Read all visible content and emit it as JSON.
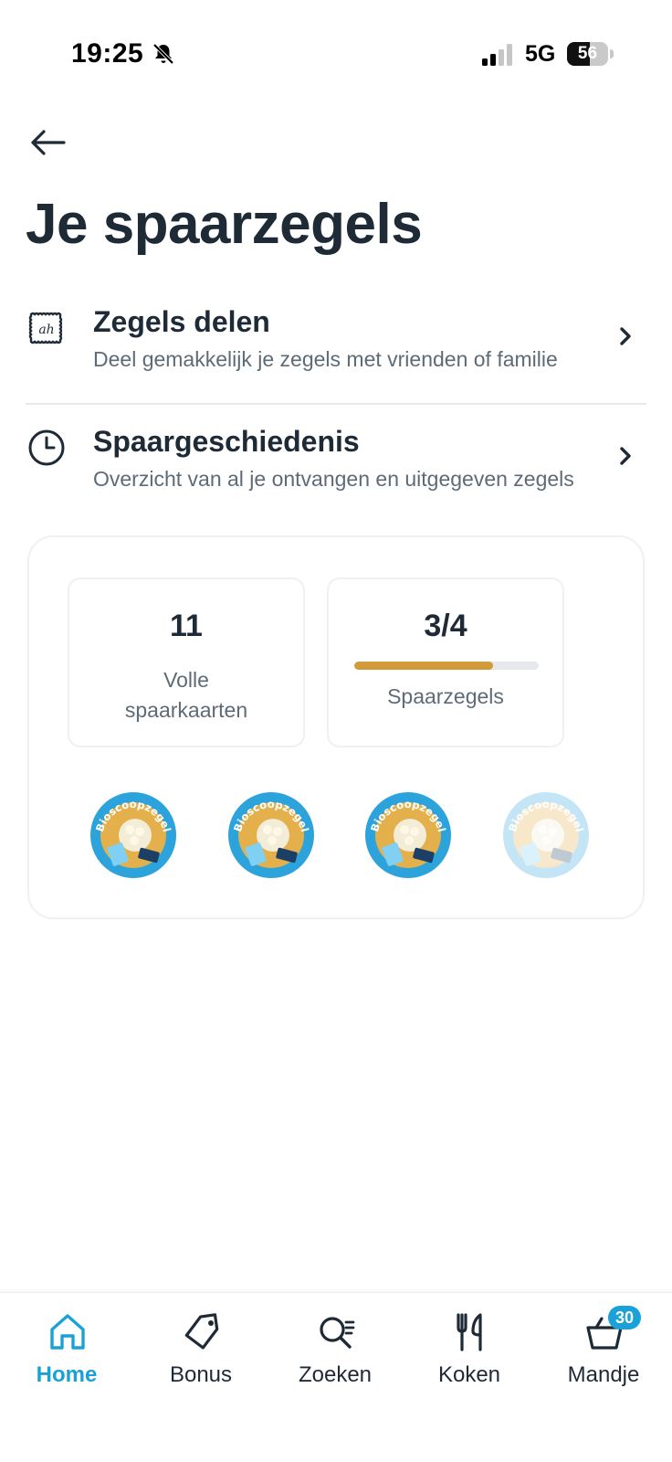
{
  "status_bar": {
    "time": "19:25",
    "network": "5G",
    "battery": "56",
    "battery_level": 0.56
  },
  "header": {
    "title": "Je spaarzegels"
  },
  "menu": [
    {
      "title": "Zegels delen",
      "subtitle": "Deel gemakkelijk je zegels met vrienden of familie",
      "icon": "ah-stamp-icon"
    },
    {
      "title": "Spaargeschiedenis",
      "subtitle": "Overzicht van al je ontvangen en uitgegeven zegels",
      "icon": "clock-icon"
    }
  ],
  "summary": {
    "full_cards_value": "11",
    "full_cards_label_line1": "Volle",
    "full_cards_label_line2": "spaarkaarten",
    "stamps_value": "3/4",
    "stamps_label": "Spaarzegels",
    "stamps_progress": 0.75,
    "stamp_text": "Bioscoopzegel",
    "stamps_collected": 3,
    "stamps_total": 4
  },
  "bottom_nav": [
    {
      "label": "Home",
      "icon": "home-icon",
      "active": true
    },
    {
      "label": "Bonus",
      "icon": "tag-icon",
      "active": false
    },
    {
      "label": "Zoeken",
      "icon": "search-icon",
      "active": false
    },
    {
      "label": "Koken",
      "icon": "cutlery-icon",
      "active": false
    },
    {
      "label": "Mandje",
      "icon": "basket-icon",
      "active": false,
      "badge": "30"
    }
  ],
  "colors": {
    "accent": "#1aa2d8",
    "text": "#1f2a37",
    "muted": "#5d6b78",
    "progress": "#d19a3a"
  }
}
